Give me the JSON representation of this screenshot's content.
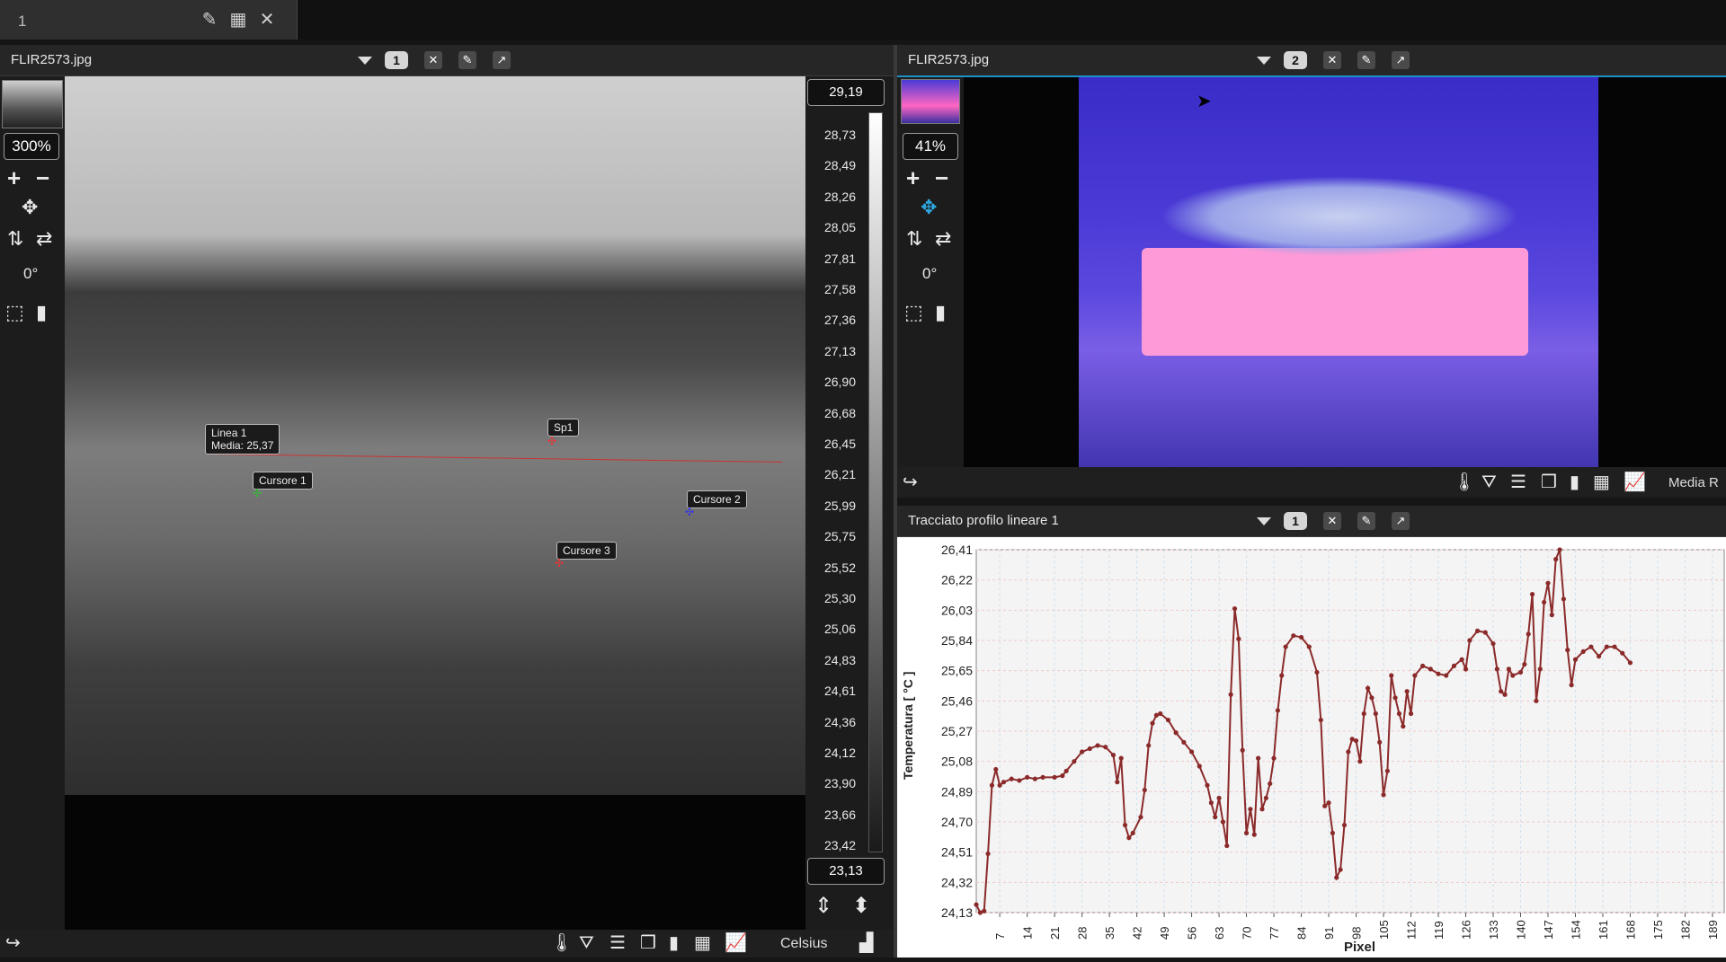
{
  "tabbar": {
    "tab_number": "1"
  },
  "left_pane": {
    "filename": "FLIR2573.jpg",
    "badge": "1",
    "zoom": "300%",
    "rotation": "0°",
    "scale_max": "29,19",
    "scale_min": "23,13",
    "scale_labels": [
      "28,73",
      "28,49",
      "28,26",
      "28,05",
      "27,81",
      "27,58",
      "27,36",
      "27,13",
      "26,90",
      "26,68",
      "26,45",
      "26,21",
      "25,99",
      "25,75",
      "25,52",
      "25,30",
      "25,06",
      "24,83",
      "24,61",
      "24,36",
      "24,12",
      "23,90",
      "23,66",
      "23,42"
    ],
    "overlays": {
      "line1_name": "Linea 1",
      "line1_mean": "Media: 25,37",
      "spot": "Sp1",
      "cursor1": "Cursore 1",
      "cursor2": "Cursore 2",
      "cursor3": "Cursore 3"
    },
    "unit": "Celsius"
  },
  "right_pane": {
    "filename": "FLIR2573.jpg",
    "badge": "2",
    "zoom": "41%",
    "rotation": "0°",
    "toolbar_text": "Media R"
  },
  "profile_pane": {
    "title": "Tracciato profilo lineare 1",
    "badge": "1"
  },
  "chart_data": {
    "type": "line",
    "title": "",
    "xlabel": "Pixel",
    "ylabel": "Temperatura [ °C ]",
    "y_ticks": [
      "26,41",
      "26,22",
      "26,03",
      "25,84",
      "25,65",
      "25,46",
      "25,27",
      "25,08",
      "24,89",
      "24,70",
      "24,51",
      "24,32",
      "24,13"
    ],
    "x_ticks": [
      "7",
      "14",
      "21",
      "28",
      "35",
      "42",
      "49",
      "56",
      "63",
      "70",
      "77",
      "84",
      "91",
      "98",
      "105",
      "112",
      "119",
      "126",
      "133",
      "140",
      "147",
      "154",
      "161",
      "168",
      "175",
      "182",
      "189"
    ],
    "ylim": [
      24.13,
      26.41
    ],
    "xlim": [
      1,
      192
    ],
    "grid": true,
    "color": "#8b2a2a",
    "points": [
      [
        1,
        24.18
      ],
      [
        2,
        24.13
      ],
      [
        3,
        24.14
      ],
      [
        4,
        24.5
      ],
      [
        5,
        24.93
      ],
      [
        6,
        25.03
      ],
      [
        7,
        24.93
      ],
      [
        8,
        24.95
      ],
      [
        10,
        24.97
      ],
      [
        12,
        24.96
      ],
      [
        14,
        24.98
      ],
      [
        16,
        24.97
      ],
      [
        18,
        24.98
      ],
      [
        21,
        24.98
      ],
      [
        23,
        24.99
      ],
      [
        24,
        25.02
      ],
      [
        26,
        25.08
      ],
      [
        28,
        25.14
      ],
      [
        30,
        25.16
      ],
      [
        32,
        25.18
      ],
      [
        34,
        25.17
      ],
      [
        36,
        25.12
      ],
      [
        37,
        24.95
      ],
      [
        38,
        25.1
      ],
      [
        39,
        24.68
      ],
      [
        40,
        24.6
      ],
      [
        41,
        24.63
      ],
      [
        43,
        24.73
      ],
      [
        44,
        24.9
      ],
      [
        45,
        25.18
      ],
      [
        46,
        25.32
      ],
      [
        47,
        25.37
      ],
      [
        48,
        25.38
      ],
      [
        50,
        25.34
      ],
      [
        52,
        25.26
      ],
      [
        54,
        25.2
      ],
      [
        56,
        25.14
      ],
      [
        58,
        25.05
      ],
      [
        60,
        24.93
      ],
      [
        61,
        24.82
      ],
      [
        62,
        24.73
      ],
      [
        63,
        24.85
      ],
      [
        64,
        24.7
      ],
      [
        65,
        24.55
      ],
      [
        66,
        25.5
      ],
      [
        67,
        26.04
      ],
      [
        68,
        25.85
      ],
      [
        69,
        25.15
      ],
      [
        70,
        24.63
      ],
      [
        71,
        24.78
      ],
      [
        72,
        24.62
      ],
      [
        73,
        25.1
      ],
      [
        74,
        24.78
      ],
      [
        75,
        24.85
      ],
      [
        76,
        24.94
      ],
      [
        77,
        25.1
      ],
      [
        78,
        25.4
      ],
      [
        79,
        25.62
      ],
      [
        80,
        25.8
      ],
      [
        82,
        25.87
      ],
      [
        84,
        25.86
      ],
      [
        86,
        25.8
      ],
      [
        88,
        25.64
      ],
      [
        89,
        25.34
      ],
      [
        90,
        24.8
      ],
      [
        91,
        24.82
      ],
      [
        92,
        24.63
      ],
      [
        93,
        24.35
      ],
      [
        94,
        24.4
      ],
      [
        95,
        24.68
      ],
      [
        96,
        25.14
      ],
      [
        97,
        25.22
      ],
      [
        98,
        25.21
      ],
      [
        99,
        25.08
      ],
      [
        100,
        25.38
      ],
      [
        101,
        25.54
      ],
      [
        102,
        25.48
      ],
      [
        103,
        25.38
      ],
      [
        104,
        25.2
      ],
      [
        105,
        24.87
      ],
      [
        106,
        25.02
      ],
      [
        107,
        25.62
      ],
      [
        108,
        25.48
      ],
      [
        109,
        25.38
      ],
      [
        110,
        25.3
      ],
      [
        111,
        25.52
      ],
      [
        112,
        25.38
      ],
      [
        113,
        25.62
      ],
      [
        115,
        25.68
      ],
      [
        117,
        25.66
      ],
      [
        119,
        25.63
      ],
      [
        121,
        25.62
      ],
      [
        123,
        25.68
      ],
      [
        125,
        25.72
      ],
      [
        126,
        25.66
      ],
      [
        127,
        25.84
      ],
      [
        129,
        25.9
      ],
      [
        131,
        25.89
      ],
      [
        133,
        25.82
      ],
      [
        134,
        25.66
      ],
      [
        135,
        25.52
      ],
      [
        136,
        25.5
      ],
      [
        137,
        25.66
      ],
      [
        138,
        25.62
      ],
      [
        140,
        25.64
      ],
      [
        141,
        25.69
      ],
      [
        142,
        25.88
      ],
      [
        143,
        26.13
      ],
      [
        144,
        25.46
      ],
      [
        145,
        25.66
      ],
      [
        146,
        26.08
      ],
      [
        147,
        26.2
      ],
      [
        148,
        26.0
      ],
      [
        149,
        26.35
      ],
      [
        150,
        26.41
      ],
      [
        151,
        26.1
      ],
      [
        152,
        25.78
      ],
      [
        153,
        25.56
      ],
      [
        154,
        25.72
      ],
      [
        156,
        25.77
      ],
      [
        158,
        25.8
      ],
      [
        160,
        25.74
      ],
      [
        162,
        25.8
      ],
      [
        164,
        25.8
      ],
      [
        166,
        25.76
      ],
      [
        168,
        25.7
      ]
    ]
  }
}
